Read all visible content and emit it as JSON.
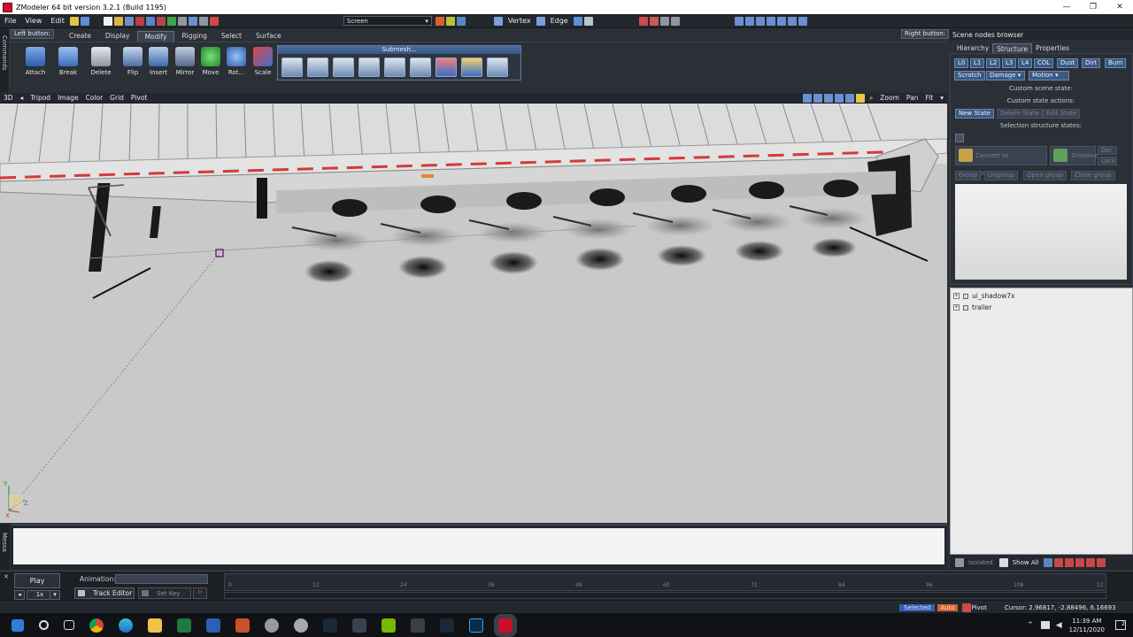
{
  "window": {
    "title": "ZModeler 64 bit version 3.2.1 (Build 1195)",
    "min": "—",
    "max": "❐",
    "close": "✕"
  },
  "menu": [
    "File",
    "View",
    "Edit"
  ],
  "toolbar": {
    "screen_select": "Screen",
    "vertex": "Vertex",
    "edge": "Edge"
  },
  "ribbon": {
    "left_button": "Left button:",
    "right_button": "Right button:",
    "tabs": [
      "Create",
      "Display",
      "Modify",
      "Rigging",
      "Select",
      "Surface"
    ],
    "active_tab": "Modify",
    "tools": [
      "Attach",
      "Break",
      "Delete",
      "Flip",
      "Insert",
      "Mirror",
      "Move",
      "Rot...",
      "Scale"
    ],
    "submesh_title": "Submesh..."
  },
  "side_strips": {
    "commands": "Commands",
    "messages": "Messa"
  },
  "viewport": {
    "mode": "3D",
    "menu": [
      "Tripod",
      "Image",
      "Color",
      "Grid",
      "Pivot"
    ],
    "nav": [
      "Zoom",
      "Pan",
      "Fit"
    ],
    "axis_y": "Y",
    "axis_x": "X",
    "axis_z": "Z"
  },
  "right_panel": {
    "header": "Scene nodes browser",
    "tabs": [
      "Hierarchy",
      "Structure",
      "Properties"
    ],
    "active_tab": "Structure",
    "lod_row": [
      "L0",
      "L1",
      "L2",
      "L3",
      "L4",
      "COL",
      "Dust",
      "Dirt",
      "Burn"
    ],
    "state_row": [
      "Scratch",
      "Damage",
      "Motion"
    ],
    "custom_scene_states": "Custom scene state:",
    "custom_state_actions": "Custom state actions:",
    "state_buttons": [
      "New State",
      "Delete State",
      "Edit State"
    ],
    "selection_states": "Selection structure states:",
    "convert_compound": "Convert to Compound",
    "dissolve": "Dissolve",
    "del": "Del",
    "lock": "Lock",
    "group_row": [
      "Group",
      "Ungroup",
      "Open group",
      "Close group"
    ],
    "tree_nodes": [
      "ui_shadow7x",
      "trailer"
    ],
    "isolated": "Isolated",
    "show_all": "Show All"
  },
  "animation": {
    "play": "Play",
    "speed": "1x",
    "label": "Animation:",
    "track_editor": "Track Editor",
    "set_key": "Set Key",
    "ticks": [
      "0",
      "12",
      "24",
      "36",
      "48",
      "60",
      "72",
      "84",
      "96",
      "108",
      "12"
    ]
  },
  "status": {
    "selected": "Selected",
    "auto": "Auto",
    "pivot": "Pivot",
    "cursor": "Cursor: 2.96817, -2.88496, 6.16693"
  },
  "taskbar": {
    "time": "11:39 AM",
    "date": "12/11/2020",
    "notif": "2"
  },
  "colors": {
    "accent": "#3a5a86",
    "brand": "#c8102e",
    "viewport_bg": "#c9c9c9"
  }
}
